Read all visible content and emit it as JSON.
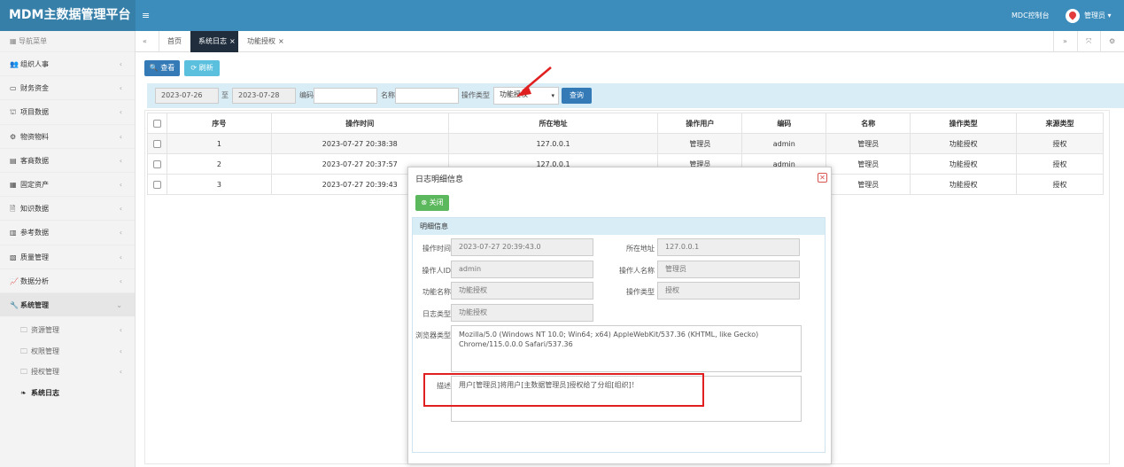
{
  "app": {
    "brand": "MDM主数据管理平台",
    "menu_toggle": "≡",
    "mdc_link": "MDC控制台",
    "user": "管理员 ▾"
  },
  "sidebar": {
    "header": "导航菜单",
    "items": [
      {
        "label": "组织人事",
        "icon": "👥"
      },
      {
        "label": "财务资金",
        "icon": "▭"
      },
      {
        "label": "项目数据",
        "icon": "⛫"
      },
      {
        "label": "物资物料",
        "icon": "⚙"
      },
      {
        "label": "客商数据",
        "icon": "▤"
      },
      {
        "label": "固定资产",
        "icon": "▦"
      },
      {
        "label": "知识数据",
        "icon": "🗎"
      },
      {
        "label": "参考数据",
        "icon": "▥"
      },
      {
        "label": "质量管理",
        "icon": "▧"
      },
      {
        "label": "数据分析",
        "icon": "📈"
      },
      {
        "label": "系统管理",
        "icon": "🔧"
      }
    ],
    "subitems": [
      {
        "label": "资源管理"
      },
      {
        "label": "权限管理"
      },
      {
        "label": "授权管理"
      },
      {
        "label": "系统日志"
      }
    ],
    "chevron": "‹",
    "chevron_open": "⌄",
    "folder": "🗀",
    "leaf": "❧"
  },
  "tabs": {
    "prev": "«",
    "home": "首页",
    "log": "系统日志",
    "auth": "功能授权",
    "close": "×",
    "next": "»",
    "full": "⤧",
    "gear": "⚙"
  },
  "toolbar": {
    "search": "🔍 查看",
    "refresh": "⟳ 刷新"
  },
  "filter": {
    "date_from": "2023-07-26",
    "date_sep": "至",
    "date_to": "2023-07-28",
    "code_label": "编码",
    "name_label": "名称",
    "optype_label": "操作类型",
    "optype_value": "功能授权",
    "caret": "▾",
    "query": "查询"
  },
  "table": {
    "headers": [
      "序号",
      "操作时间",
      "所在地址",
      "操作用户",
      "编码",
      "名称",
      "操作类型",
      "来源类型"
    ],
    "rows": [
      [
        "1",
        "2023-07-27 20:38:38",
        "127.0.0.1",
        "管理员",
        "admin",
        "管理员",
        "功能授权",
        "授权"
      ],
      [
        "2",
        "2023-07-27 20:37:57",
        "127.0.0.1",
        "管理员",
        "admin",
        "管理员",
        "功能授权",
        "授权"
      ],
      [
        "3",
        "2023-07-27 20:39:43",
        "",
        "",
        "",
        "管理员",
        "功能授权",
        "授权"
      ]
    ]
  },
  "modal": {
    "title": "日志明细信息",
    "close_x": "✕",
    "close_btn": "⊗ 关闭",
    "section": "明细信息",
    "fields": {
      "op_time_label": "操作时间",
      "op_time": "2023-07-27 20:39:43.0",
      "addr_label": "所在地址",
      "addr": "127.0.0.1",
      "op_id_label": "操作人ID",
      "op_id": "admin",
      "op_name_label": "操作人名称",
      "op_name": "管理员",
      "func_label": "功能名称",
      "func": "功能授权",
      "optype_label": "操作类型",
      "optype": "授权",
      "logtype_label": "日志类型",
      "logtype": "功能授权",
      "browser_label": "浏览器类型",
      "browser": "Mozilla/5.0 (Windows NT 10.0; Win64; x64) AppleWebKit/537.36 (KHTML, like Gecko) Chrome/115.0.0.0 Safari/537.36",
      "desc_label": "描述",
      "desc": "用户[管理员]将用户[主数据管理员]授权给了分组[组织]！"
    }
  },
  "colors": {
    "topbar": "#3c8dbc",
    "primary": "#337ab7",
    "info": "#5bc0de",
    "success": "#5cb85c",
    "annotation": "#e02020"
  }
}
